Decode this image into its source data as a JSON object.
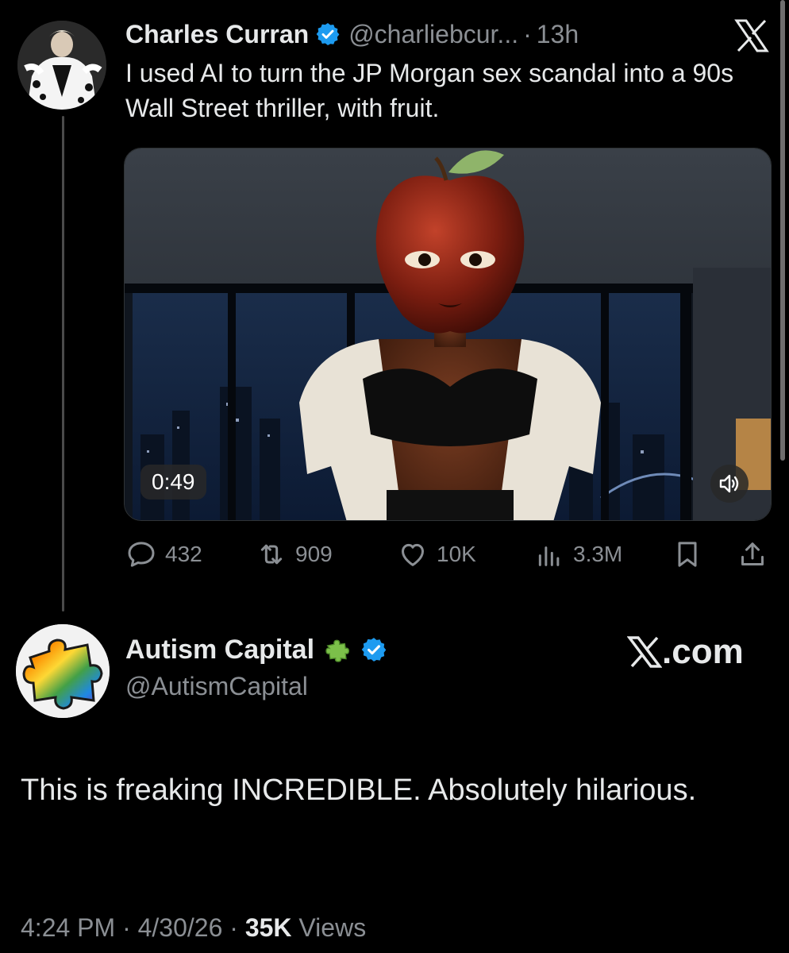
{
  "original_tweet": {
    "author_name": "Charles Curran",
    "handle": "@charliebcur...",
    "separator": "·",
    "time_ago": "13h",
    "text": "I used AI to turn the JP Morgan sex scandal into a 90s Wall Street thriller, with fruit.",
    "media": {
      "duration": "0:49"
    },
    "actions": {
      "replies": "432",
      "reposts": "909",
      "likes": "10K",
      "views": "3.3M"
    }
  },
  "reply": {
    "author_name": "Autism Capital",
    "handle": "@AutismCapital",
    "brand": ".com",
    "text": "This is freaking INCREDIBLE. Absolutely hilarious.",
    "time": "4:24 PM",
    "date": "4/30/26",
    "separator": "·",
    "views_count": "35K",
    "views_label": "Views"
  },
  "colors": {
    "background": "#000000",
    "text_primary": "#e7e9ea",
    "text_secondary": "#8b8f94",
    "verified_blue": "#1d9bf0"
  },
  "icons": [
    "x-logo-icon",
    "verified-badge-icon",
    "reply-icon",
    "repost-icon",
    "like-icon",
    "views-icon",
    "bookmark-icon",
    "share-icon",
    "volume-icon",
    "puzzle-icon"
  ]
}
